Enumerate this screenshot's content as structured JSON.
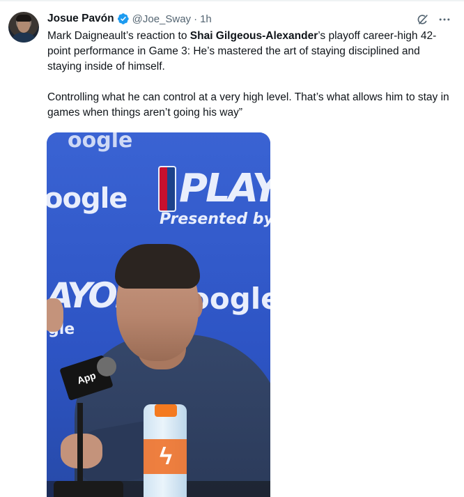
{
  "post": {
    "author": {
      "display_name": "Josue Pavón",
      "handle": "@Joe_Sway",
      "verified": true,
      "avatar_icon": "profile-photo"
    },
    "separator": "·",
    "time": "1h",
    "actions": {
      "grok_icon": "grok-icon",
      "more_icon": "more-horizontal-icon"
    },
    "text": {
      "p1_a": "Mark Daigneault’s reaction to ",
      "p1_bold": "Shai Gilgeous-Alexander",
      "p1_b": "’s playoff career-high 42-point performance in Game 3: He’s mastered the art of staying disciplined and staying inside of himself.",
      "p2": "Controlling what he can control at a very high level. That’s what allows him to stay in games when things aren’t going his way”"
    },
    "media": {
      "backdrop_text": {
        "playoffs_top": "PLAYOFF",
        "presented_by": "Presented by Google",
        "oogle_left": "oogle",
        "playoffs_left": "AYOFFS",
        "oogle_right": "oogle",
        "gle_small": "gle",
        "mic_flag": "App"
      }
    },
    "colors": {
      "verified_blue": "#1d9bf0",
      "secondary_text": "#536471",
      "backdrop_blue": "#2f57c7"
    }
  }
}
